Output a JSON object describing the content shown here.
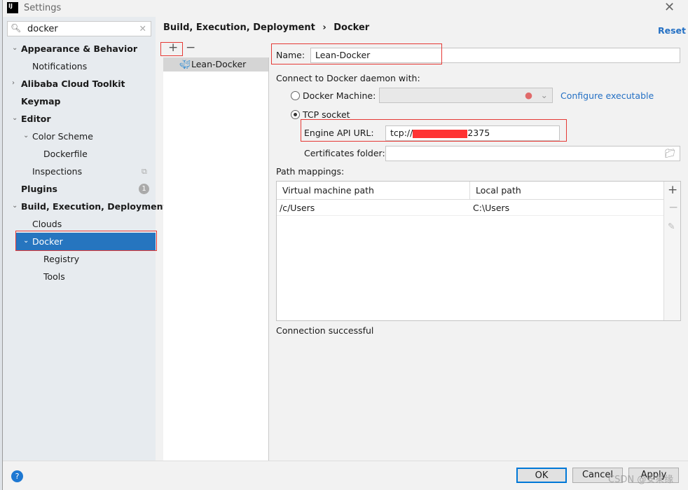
{
  "window": {
    "title": "Settings",
    "logo": "IJ"
  },
  "search": {
    "value": "docker"
  },
  "tree": [
    {
      "label": "Appearance & Behavior",
      "bold": true,
      "expanded": true
    },
    {
      "label": "Notifications"
    },
    {
      "label": "Alibaba Cloud Toolkit",
      "bold": true,
      "expanded": false
    },
    {
      "label": "Keymap",
      "bold": true
    },
    {
      "label": "Editor",
      "bold": true,
      "expanded": true
    },
    {
      "label": "Color Scheme",
      "expanded": true
    },
    {
      "label": "Dockerfile"
    },
    {
      "label": "Inspections"
    },
    {
      "label": "Plugins",
      "bold": true,
      "badge": "1"
    },
    {
      "label": "Build, Execution, Deployment",
      "bold": true,
      "expanded": true
    },
    {
      "label": "Clouds"
    },
    {
      "label": "Docker",
      "selected": true,
      "expanded": true
    },
    {
      "label": "Registry"
    },
    {
      "label": "Tools"
    }
  ],
  "breadcrumb": {
    "parent": "Build, Execution, Deployment",
    "sep": "›",
    "current": "Docker"
  },
  "reset": "Reset",
  "list": {
    "add": "+",
    "remove": "−",
    "items": [
      "Lean-Docker"
    ]
  },
  "form": {
    "name_label": "Name:",
    "name_value": "Lean-Docker",
    "connect_label": "Connect to Docker daemon with:",
    "docker_machine": "Docker Machine:",
    "configure": "Configure executable",
    "tcp": "TCP socket",
    "selected_option": "TCP socket",
    "engine_label": "Engine API URL:",
    "engine_prefix": "tcp://",
    "engine_suffix": "2375",
    "certs_label": "Certificates folder:",
    "path_label": "Path mappings:",
    "columns": [
      "Virtual machine path",
      "Local path"
    ],
    "rows": [
      [
        "/c/Users",
        "C:\\Users"
      ]
    ],
    "status": "Connection successful"
  },
  "buttons": {
    "ok": "OK",
    "cancel": "Cancel",
    "apply": "Apply",
    "help": "?"
  },
  "watermark": "CSDN @安果缘",
  "colors": {
    "selection": "#2675bf",
    "link": "#2470c4",
    "highlight": "#e53935"
  }
}
